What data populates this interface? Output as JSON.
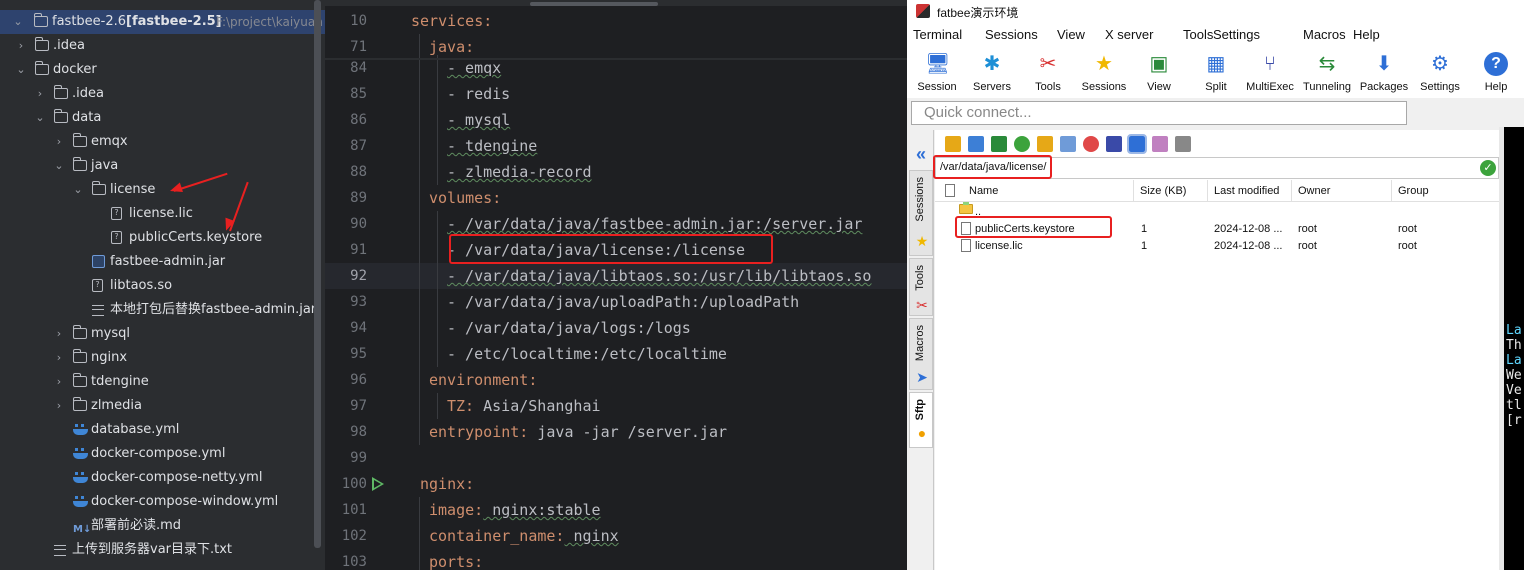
{
  "project_tree": {
    "root": {
      "name": "fastbee-2.6",
      "module": "[fastbee-2.5]",
      "path": "F:\\project\\kaiyuan"
    },
    "items": [
      {
        "label": ".idea",
        "kind": "folder",
        "expanded": false
      },
      {
        "label": "docker",
        "kind": "folder",
        "expanded": true
      },
      {
        "label": ".idea",
        "kind": "folder",
        "expanded": false
      },
      {
        "label": "data",
        "kind": "folder",
        "expanded": true
      },
      {
        "label": "emqx",
        "kind": "folder",
        "expanded": false
      },
      {
        "label": "java",
        "kind": "folder",
        "expanded": true
      },
      {
        "label": "license",
        "kind": "folder",
        "expanded": true
      },
      {
        "label": "license.lic",
        "kind": "file"
      },
      {
        "label": "publicCerts.keystore",
        "kind": "file"
      },
      {
        "label": "fastbee-admin.jar",
        "kind": "jar"
      },
      {
        "label": "libtaos.so",
        "kind": "file"
      },
      {
        "label": "本地打包后替换fastbee-admin.jar",
        "kind": "text"
      },
      {
        "label": "mysql",
        "kind": "folder",
        "expanded": false
      },
      {
        "label": "nginx",
        "kind": "folder",
        "expanded": false
      },
      {
        "label": "tdengine",
        "kind": "folder",
        "expanded": false
      },
      {
        "label": "zlmedia",
        "kind": "folder",
        "expanded": false
      },
      {
        "label": "database.yml",
        "kind": "yml"
      },
      {
        "label": "docker-compose.yml",
        "kind": "yml"
      },
      {
        "label": "docker-compose-netty.yml",
        "kind": "yml"
      },
      {
        "label": "docker-compose-window.yml",
        "kind": "yml"
      },
      {
        "label": "部署前必读.md",
        "kind": "md"
      },
      {
        "label": "上传到服务器var目录下.txt",
        "kind": "text"
      }
    ]
  },
  "editor": {
    "lines": [
      {
        "num": "10",
        "indent": 0,
        "key": "services:",
        "value": ""
      },
      {
        "num": "71",
        "indent": 1,
        "key": "java:",
        "value": ""
      },
      {
        "num": "84",
        "indent": 2,
        "key": "",
        "value": "- emqx"
      },
      {
        "num": "85",
        "indent": 2,
        "key": "",
        "value": "- redis"
      },
      {
        "num": "86",
        "indent": 2,
        "key": "",
        "value": "- mysql"
      },
      {
        "num": "87",
        "indent": 2,
        "key": "",
        "value": "- tdengine"
      },
      {
        "num": "88",
        "indent": 2,
        "key": "",
        "value": "- zlmedia-record"
      },
      {
        "num": "89",
        "indent": 1,
        "key": "volumes:",
        "value": ""
      },
      {
        "num": "90",
        "indent": 2,
        "key": "",
        "value": "- /var/data/java/fastbee-admin.jar:/server.jar"
      },
      {
        "num": "91",
        "indent": 2,
        "key": "",
        "value": "- /var/data/java/license:/license"
      },
      {
        "num": "92",
        "indent": 2,
        "key": "",
        "value": "- /var/data/java/libtaos.so:/usr/lib/libtaos.so"
      },
      {
        "num": "93",
        "indent": 2,
        "key": "",
        "value": "- /var/data/java/uploadPath:/uploadPath"
      },
      {
        "num": "94",
        "indent": 2,
        "key": "",
        "value": "- /var/data/java/logs:/logs"
      },
      {
        "num": "95",
        "indent": 2,
        "key": "",
        "value": "- /etc/localtime:/etc/localtime"
      },
      {
        "num": "96",
        "indent": 1,
        "key": "environment:",
        "value": ""
      },
      {
        "num": "97",
        "indent": 2,
        "key": "TZ:",
        "value": " Asia/Shanghai"
      },
      {
        "num": "98",
        "indent": 1,
        "key": "entrypoint:",
        "value": " java -jar /server.jar"
      },
      {
        "num": "99",
        "indent": 0,
        "key": "",
        "value": ""
      },
      {
        "num": "100",
        "indent": 0.5,
        "key": "nginx:",
        "value": ""
      },
      {
        "num": "101",
        "indent": 1,
        "key": "image:",
        "value": " nginx:stable"
      },
      {
        "num": "102",
        "indent": 1,
        "key": "container_name:",
        "value": " nginx"
      },
      {
        "num": "103",
        "indent": 1,
        "key": "ports:",
        "value": ""
      }
    ],
    "current_line": "92",
    "colors": {
      "key": "#cf8e6d",
      "text": "#bcbec4"
    }
  },
  "moba": {
    "title": "fatbee演示环境",
    "menu": [
      "Terminal",
      "Sessions",
      "View",
      "X server",
      "Tools",
      "Settings",
      "Macros",
      "Help"
    ],
    "toolbar": [
      {
        "label": "Session",
        "icon": "session-icon"
      },
      {
        "label": "Servers",
        "icon": "servers-icon"
      },
      {
        "label": "Tools",
        "icon": "tools-icon"
      },
      {
        "label": "Sessions",
        "icon": "star-icon"
      },
      {
        "label": "View",
        "icon": "view-icon"
      },
      {
        "label": "Split",
        "icon": "split-icon"
      },
      {
        "label": "MultiExec",
        "icon": "multiexec-icon"
      },
      {
        "label": "Tunneling",
        "icon": "tunneling-icon"
      },
      {
        "label": "Packages",
        "icon": "packages-icon"
      },
      {
        "label": "Settings",
        "icon": "gear-icon"
      },
      {
        "label": "Help",
        "icon": "help-icon"
      }
    ],
    "quick_connect_placeholder": "Quick connect...",
    "side_tabs": [
      "Sessions",
      "Tools",
      "Macros",
      "Sftp"
    ],
    "sftp": {
      "path": "/var/data/java/license/",
      "columns": [
        "Name",
        "Size (KB)",
        "Last modified",
        "Owner",
        "Group"
      ],
      "files": [
        {
          "name": "..",
          "size": "",
          "modified": "",
          "owner": "",
          "group": ""
        },
        {
          "name": "publicCerts.keystore",
          "size": "1",
          "modified": "2024-12-08 ...",
          "owner": "root",
          "group": "root"
        },
        {
          "name": "license.lic",
          "size": "1",
          "modified": "2024-12-08 ...",
          "owner": "root",
          "group": "root"
        }
      ]
    },
    "terminal_lines": [
      "La",
      "Th",
      "La",
      "We",
      "Ve",
      "tl",
      "[r"
    ]
  }
}
